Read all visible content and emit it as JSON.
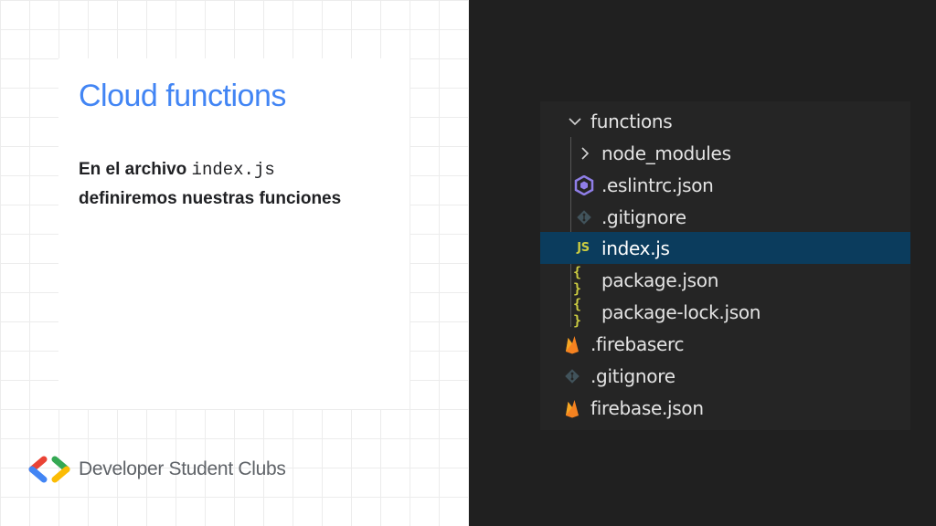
{
  "slide": {
    "title": "Cloud functions",
    "body_prefix": "En el archivo ",
    "body_code": "index.js",
    "body_line2": "definiremos nuestras funciones"
  },
  "brand": {
    "name": "Developer Student Clubs",
    "colors": {
      "blue": "#4285f4",
      "red": "#ea4335",
      "green": "#34a853",
      "yellow": "#fbbc04"
    }
  },
  "explorer": {
    "selection_color": "#0b3c5d",
    "items": [
      {
        "label": "functions",
        "icon": "chevron-down-icon",
        "kind": "folder-open"
      },
      {
        "label": "node_modules",
        "icon": "chevron-right-icon",
        "kind": "folder-closed"
      },
      {
        "label": ".eslintrc.json",
        "icon": "eslint-icon",
        "kind": "file"
      },
      {
        "label": ".gitignore",
        "icon": "git-icon",
        "kind": "file"
      },
      {
        "label": "index.js",
        "icon": "javascript-icon",
        "icon_text": "JS",
        "kind": "file",
        "selected": true
      },
      {
        "label": "package.json",
        "icon": "json-icon",
        "icon_text": "{ }",
        "kind": "file"
      },
      {
        "label": "package-lock.json",
        "icon": "json-icon",
        "icon_text": "{ }",
        "kind": "file"
      },
      {
        "label": ".firebaserc",
        "icon": "firebase-icon",
        "kind": "file"
      },
      {
        "label": ".gitignore",
        "icon": "git-icon",
        "kind": "file"
      },
      {
        "label": "firebase.json",
        "icon": "firebase-icon",
        "kind": "file"
      }
    ]
  }
}
